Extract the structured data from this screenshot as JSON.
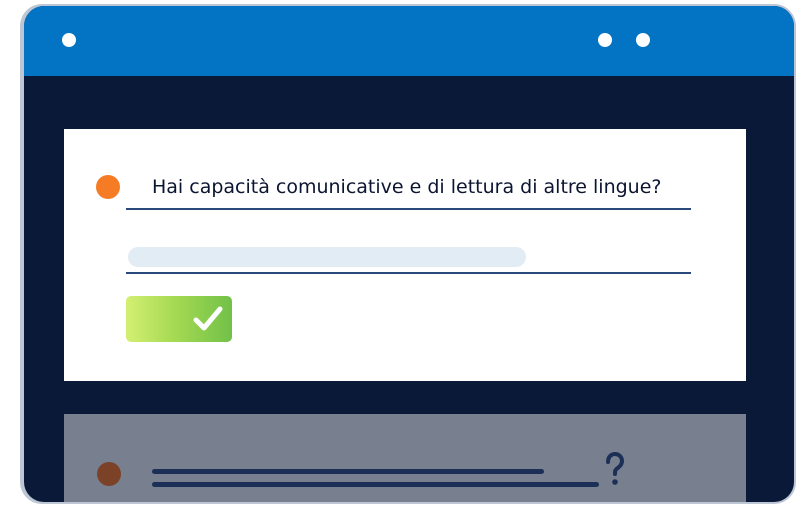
{
  "window": {
    "titlebar_color": "#0374c4",
    "background_color": "#0a1938"
  },
  "question_card": {
    "question": "Hai capacità comunicative e di lettura di altre lingue?",
    "bullet_color": "#f57c25",
    "answer_value": "",
    "confirm_icon": "check-icon",
    "confirm_color": "#8ccd4c"
  },
  "next_card": {
    "bullet_color": "#7b4228",
    "icon": "question-mark-icon"
  }
}
